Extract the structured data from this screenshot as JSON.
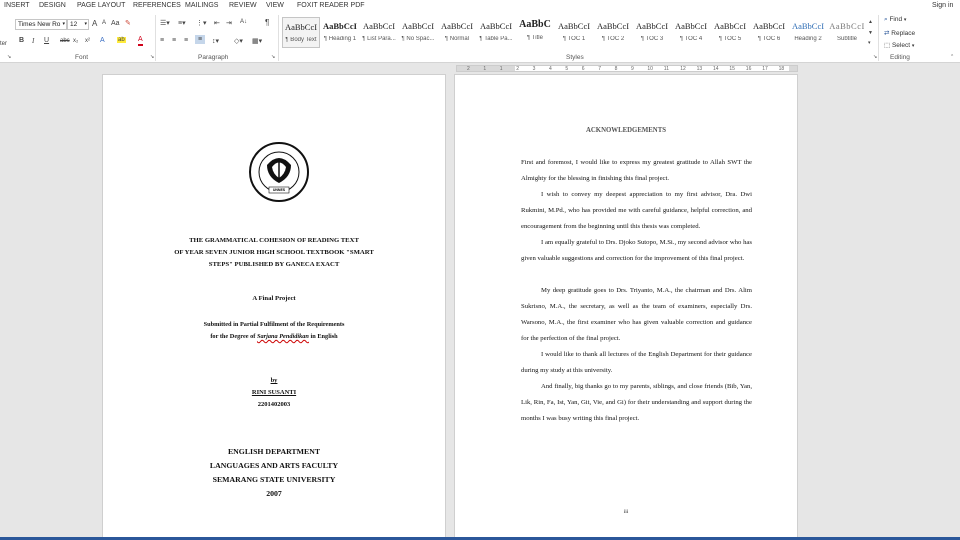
{
  "menu": {
    "insert": "INSERT",
    "design": "DESIGN",
    "page_layout": "PAGE LAYOUT",
    "references": "REFERENCES",
    "mailings": "MAILINGS",
    "review": "REVIEW",
    "view": "VIEW",
    "foxit": "FOXIT READER PDF",
    "sign_in": "Sign in"
  },
  "ribbon": {
    "clipboard_partial": "ter",
    "font_name": "Times New Ro",
    "font_size": "12",
    "font_group": "Font",
    "paragraph_group": "Paragraph",
    "styles_group": "Styles",
    "editing_group": "Editing",
    "bold": "B",
    "italic": "I",
    "underline": "U",
    "strike": "abc",
    "subscript": "x₂",
    "superscript": "x²",
    "grow": "A",
    "shrink": "A",
    "case": "Aa",
    "highlight": "ab",
    "font_color": "A",
    "pilcrow": "¶",
    "styles": [
      {
        "sample": "AaBbCcI",
        "name": "¶ Body Text"
      },
      {
        "sample": "AaBbCcI",
        "name": "¶ Heading 1"
      },
      {
        "sample": "AaBbCcI",
        "name": "¶ List Para..."
      },
      {
        "sample": "AaBbCcI",
        "name": "¶ No Spac..."
      },
      {
        "sample": "AaBbCcI",
        "name": "¶ Normal"
      },
      {
        "sample": "AaBbCcI",
        "name": "¶ Table Pa..."
      },
      {
        "sample": "AaBbC",
        "name": "¶ Title"
      },
      {
        "sample": "AaBbCcI",
        "name": "¶ TOC 1"
      },
      {
        "sample": "AaBbCcI",
        "name": "¶ TOC 2"
      },
      {
        "sample": "AaBbCcI",
        "name": "¶ TOC 3"
      },
      {
        "sample": "AaBbCcI",
        "name": "¶ TOC 4"
      },
      {
        "sample": "AaBbCcI",
        "name": "¶ TOC 5"
      },
      {
        "sample": "AaBbCcI",
        "name": "¶ TOC 6"
      },
      {
        "sample": "AaBbCcI",
        "name": "Heading 2"
      },
      {
        "sample": "AaBbCcI",
        "name": "Subtitle"
      }
    ],
    "find": "Find",
    "replace": "Replace",
    "select": "Select"
  },
  "ruler": [
    "2",
    "1",
    "1",
    "2",
    "3",
    "4",
    "5",
    "6",
    "7",
    "8",
    "9",
    "10",
    "11",
    "12",
    "13",
    "14",
    "15",
    "16",
    "17",
    "18"
  ],
  "left_page": {
    "title_line1": "THE GRAMMATICAL COHESION OF READING TEXT",
    "title_line2": "OF YEAR SEVEN JUNIOR HIGH SCHOOL TEXTBOOK \"SMART",
    "title_line3": "STEPS\" PUBLISHED BY GANECA EXACT",
    "project": "A Final Project",
    "submitted": "Submitted in Partial Fulfilment of the Requirements",
    "degree_prefix": "for the Degree of",
    "degree_italic": "Sarjana Pendidikan",
    "degree_suffix": "in English",
    "by": "by",
    "author": "RINI SUSANTI",
    "nim": "2201402003",
    "dept": "ENGLISH DEPARTMENT",
    "faculty": "LANGUAGES AND ARTS FACULTY",
    "university": "SEMARANG STATE UNIVERSITY",
    "year": "2007",
    "logo_text": "UNIVERSITAS NEGERI SEMARANG",
    "logo_label": "UNNES"
  },
  "right_page": {
    "heading": "ACKNOWLEDGEMENTS",
    "paragraphs": [
      "First and foremost, I would like to express my greatest gratitude to Allah SWT the Almighty for the blessing in finishing this final project.",
      "I wish to convey my deepest appreciation to my first advisor, Dra. Dwi Rukmini, M.Pd., who has provided me with careful guidance, helpful correction, and encouragement from the beginning until this thesis was completed.",
      "I am equally grateful to Drs. Djoko Sutopo, M.Si., my second advisor who has given valuable suggestions and correction for the improvement of this final project.",
      "My deep gratitude goes to Drs. Triyanto, M.A., the chairman and Drs. Alim Sukrisno, M.A., the secretary, as well as the team of examiners, especially Drs. Warsono, M.A., the first examiner who has given valuable correction and guidance for the perfection of the final project.",
      "I would like to thank all lectures of the English Department for their guidance during my study at this university.",
      "And finally, big thanks go to my parents, siblings, and close friends (Bib, Yan, Lik, Rin, Fa, Ist, Yan, Git, Vie, and Gi) for their understanding and support during the months I was busy writing this final project."
    ],
    "page_mark": "iii"
  },
  "colors": {
    "accent": "#2b579a",
    "heading_gray": "#555555"
  }
}
